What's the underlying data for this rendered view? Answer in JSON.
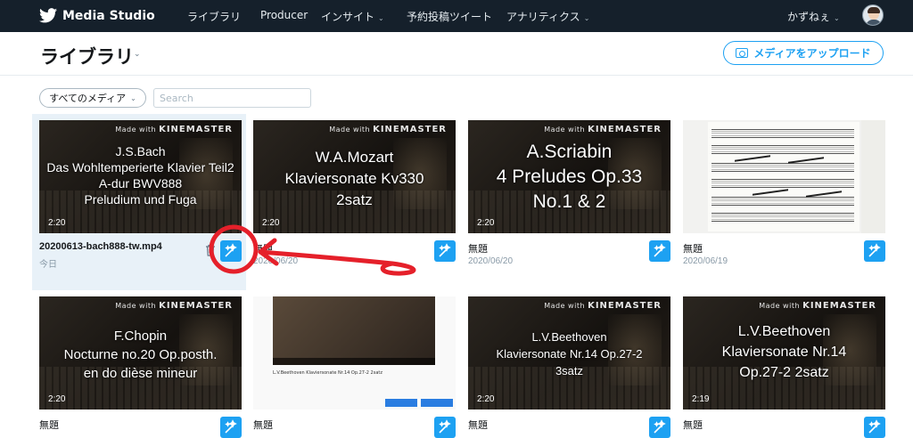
{
  "header": {
    "brand": "Media Studio",
    "nav": [
      {
        "label": "ライブラリ",
        "dropdown": false
      },
      {
        "label": "Producer",
        "dropdown": false
      },
      {
        "label": "インサイト",
        "dropdown": true
      },
      {
        "label": "予約投稿ツイート",
        "dropdown": false
      },
      {
        "label": "アナリティクス",
        "dropdown": true
      }
    ],
    "user": "かずねぇ",
    "chevron": "⌄"
  },
  "page": {
    "title": "ライブラリ",
    "title_chevron": "⌄",
    "upload_label": "メディアをアップロード"
  },
  "filters": {
    "media_filter": "すべてのメディア",
    "search_placeholder": "Search"
  },
  "colors": {
    "accent": "#1da1f2",
    "topbar": "#15202b",
    "annotation": "#e5202a"
  },
  "kinemaster": {
    "made_with": "Made with",
    "brand": "KINEMASTER"
  },
  "cards": [
    {
      "caption": "J.S.Bach\nDas Wohltemperierte Klavier Teil2\nA-dur BWV888\nPreludium und Fuga",
      "duration": "2:20",
      "name": "20200613-bach888-tw.mp4",
      "date": "今日",
      "kinemaster": true
    },
    {
      "caption": "W.A.Mozart\nKlaviersonate Kv330\n2satz",
      "duration": "2:20",
      "name": "無題",
      "date": "2020/06/20",
      "kinemaster": true
    },
    {
      "caption": "A.Scriabin\n4 Preludes Op.33\nNo.1 & 2",
      "duration": "2:20",
      "name": "無題",
      "date": "2020/06/20",
      "kinemaster": true
    },
    {
      "caption": "",
      "duration": "",
      "name": "無題",
      "date": "2020/06/19",
      "kinemaster": false
    },
    {
      "caption": "F.Chopin\nNocturne no.20 Op.posth.\nen do dièse mineur",
      "duration": "2:20",
      "name": "無題",
      "date": "",
      "kinemaster": true
    },
    {
      "caption": "",
      "duration": "",
      "name": "無題",
      "date": "",
      "kinemaster": false,
      "yt_title": "L.V.Beethoven Klaviersonate Nr.14 Op.27-2 2satz"
    },
    {
      "caption": "L.V.Beethoven\nKlaviersonate Nr.14 Op.27-2\n3satz",
      "duration": "2:20",
      "name": "無題",
      "date": "",
      "kinemaster": true
    },
    {
      "caption": "L.V.Beethoven\nKlaviersonate Nr.14\nOp.27-2 2satz",
      "duration": "2:19",
      "name": "無題",
      "date": "",
      "kinemaster": true
    }
  ]
}
